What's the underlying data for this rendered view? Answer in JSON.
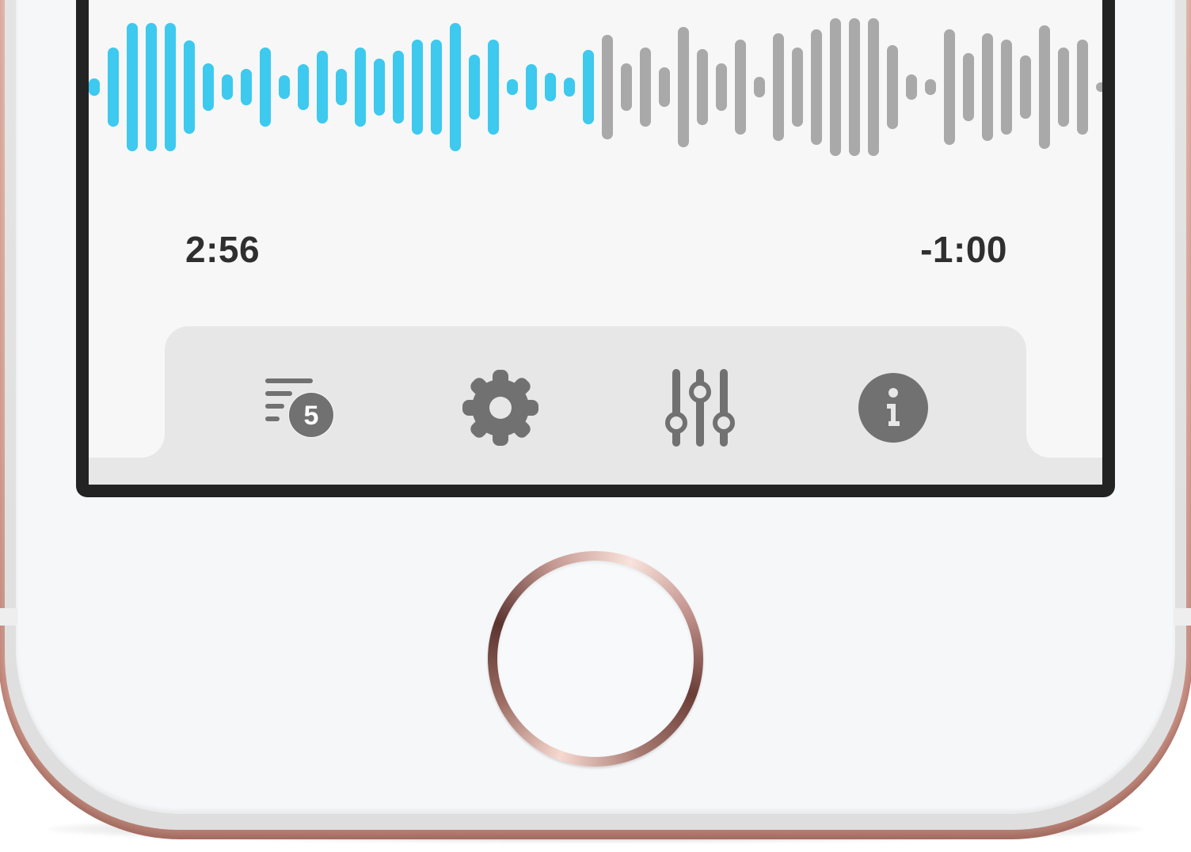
{
  "player": {
    "elapsed": "2:56",
    "remaining": "-1:00",
    "played_color": "#3ec9ee",
    "unplayed_color": "#a9a9a9",
    "waveform": {
      "played": [
        22,
        100,
        162,
        162,
        162,
        118,
        60,
        32,
        46,
        100,
        30,
        58,
        92,
        46,
        100,
        72,
        92,
        120,
        120,
        162,
        82,
        120,
        20,
        58,
        36,
        24,
        94
      ],
      "unplayed": [
        132,
        60,
        100,
        50,
        152,
        96,
        60,
        120,
        26,
        136,
        100,
        146,
        174,
        174,
        174,
        106,
        32,
        20,
        146,
        86,
        136,
        120,
        80,
        156,
        100,
        120,
        12
      ]
    }
  },
  "toolbar": {
    "queue_icon": "queue-list-icon",
    "queue_count": "5",
    "settings_icon": "gear-icon",
    "equalizer_icon": "sliders-icon",
    "info_icon": "info-icon",
    "icon_color": "#717171"
  },
  "device": {
    "frame_color": "#d9a79a",
    "home_button": "home-button"
  }
}
